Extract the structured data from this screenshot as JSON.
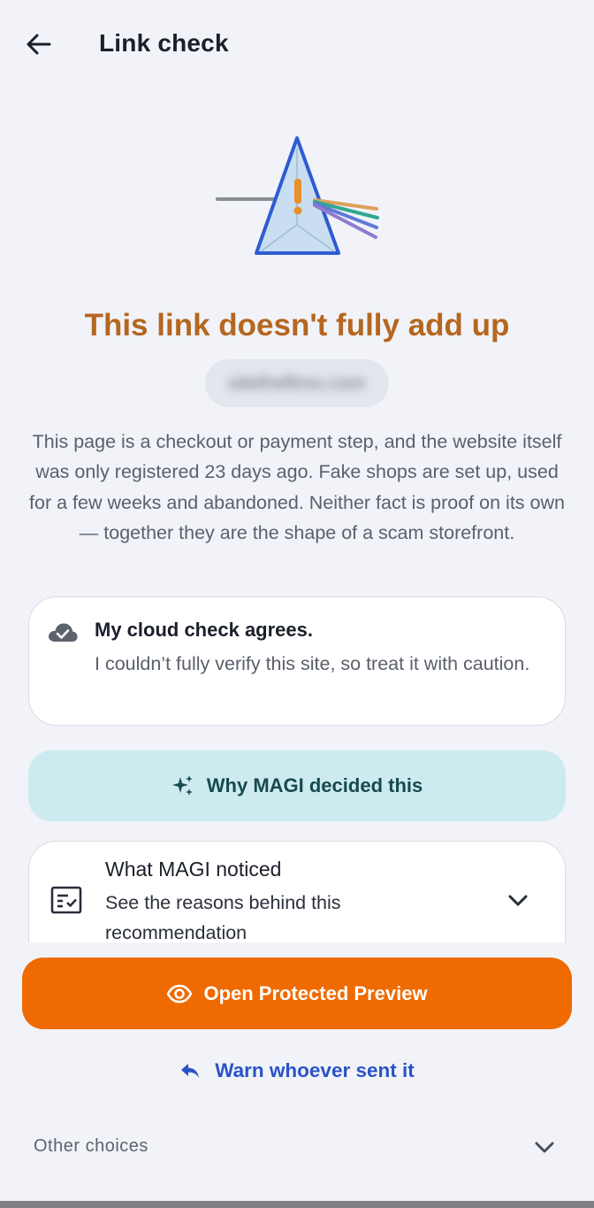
{
  "header": {
    "title": "Link check",
    "back_icon": "arrow-left-icon"
  },
  "illustration": {
    "icon": "prism-warning-icon",
    "colors": {
      "outline": "#2f5bd3",
      "fill": "#c9def0",
      "warning": "#e8902a"
    }
  },
  "verdict": {
    "headline": "This link doesn't fully add up",
    "url": "sitetheftmo.com",
    "description": "This page is a checkout or payment step, and the website itself was only registered 23 days ago. Fake shops are set up, used for a few weeks and abandoned. Neither fact is proof on its own — together they are the shape of a scam storefront."
  },
  "cloud_check": {
    "icon": "cloud-check-icon",
    "title": "My cloud check agrees.",
    "body": "I couldn’t fully verify this site, so treat it with caution."
  },
  "why_button": {
    "icon": "sparkle-icon",
    "label": "Why MAGI decided this"
  },
  "noticed": {
    "icon": "checklist-icon",
    "title": "What MAGI noticed",
    "subtitle": "See the reasons behind this recommendation",
    "chevron": "chevron-down-icon"
  },
  "primary_action": {
    "icon": "eye-icon",
    "label": "Open Protected Preview"
  },
  "warn_action": {
    "icon": "reply-icon",
    "label": "Warn whoever sent it"
  },
  "other_choices": {
    "label": "Other choices",
    "chevron": "chevron-down-icon"
  },
  "colors": {
    "background": "#f1f3f8",
    "headline": "#b5661f",
    "primary": "#ef6a00",
    "link": "#2a52c9",
    "why_bg": "#cdebef"
  }
}
